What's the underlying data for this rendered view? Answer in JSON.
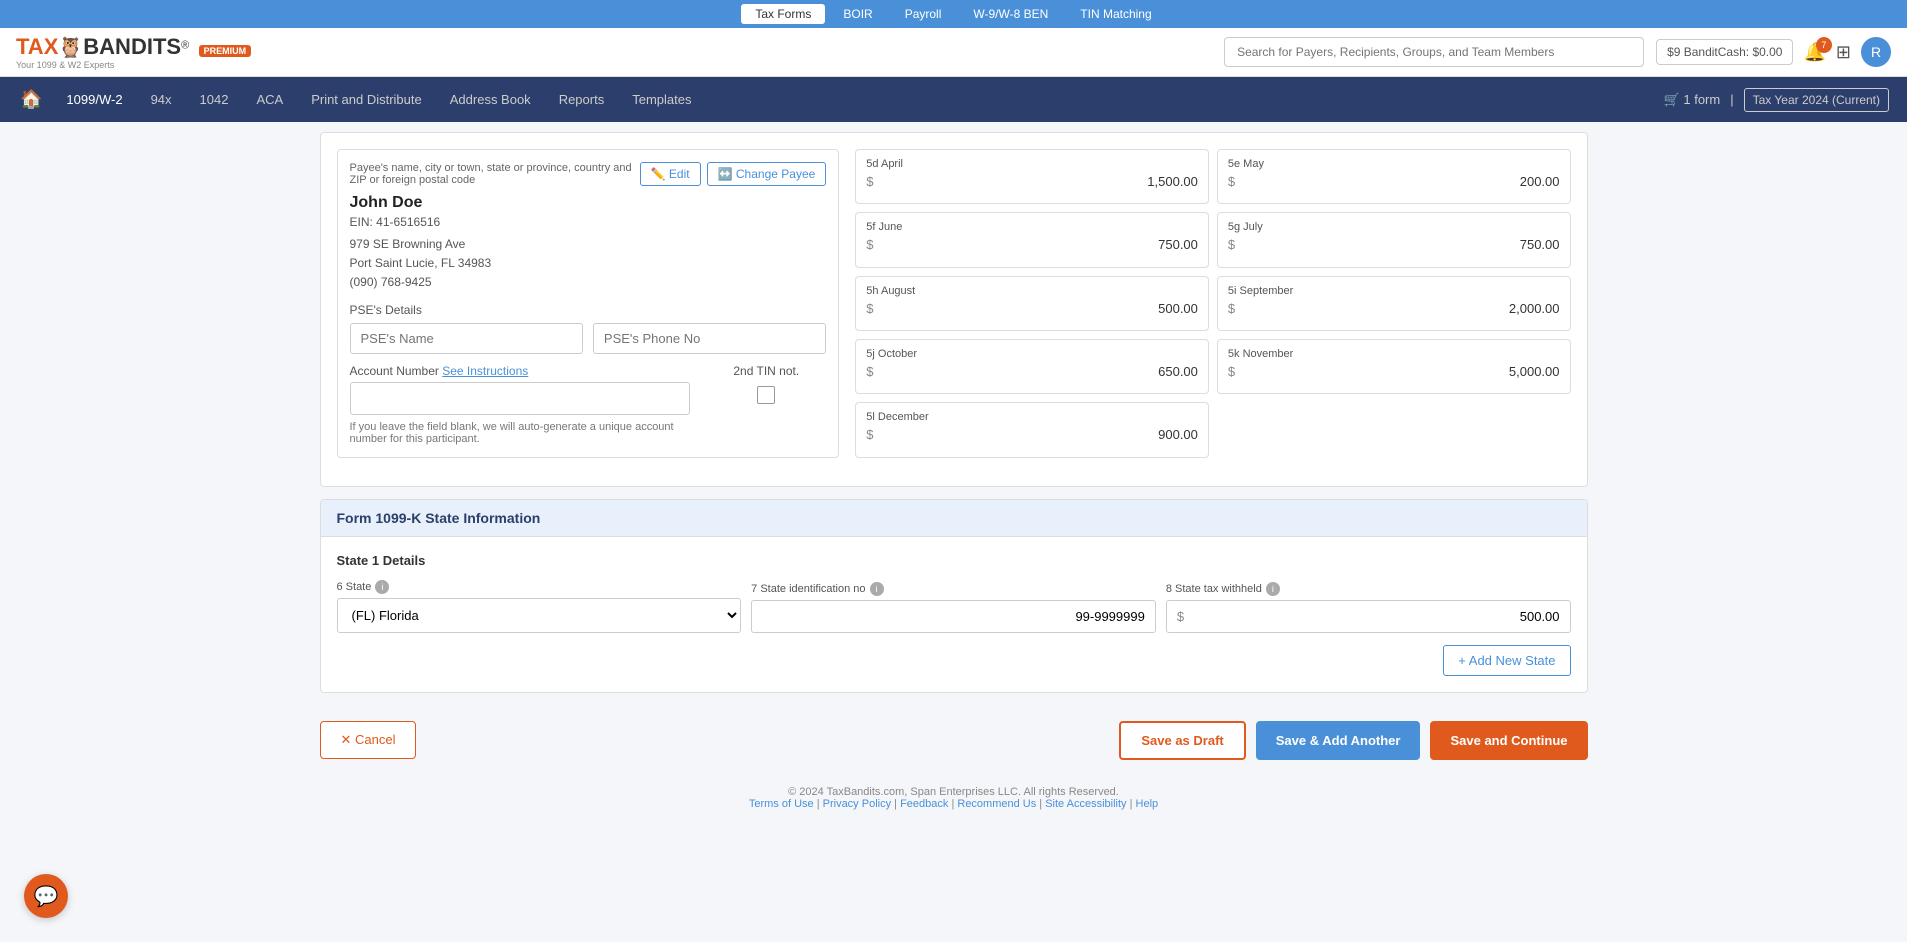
{
  "topNav": {
    "items": [
      {
        "label": "Tax Forms",
        "active": true
      },
      {
        "label": "BOIR",
        "active": false
      },
      {
        "label": "Payroll",
        "active": false
      },
      {
        "label": "W-9/W-8 BEN",
        "active": false
      },
      {
        "label": "TIN Matching",
        "active": false
      }
    ]
  },
  "header": {
    "logo": "TAXBANDITS",
    "logoSub": "Your 1099 & W2 Experts",
    "premium": "PREMIUM",
    "searchPlaceholder": "Search for Payers, Recipients, Groups, and Team Members",
    "banditCash": "$9 BanditCash: $0.00",
    "notifCount": "7",
    "avatar": "R"
  },
  "secondNav": {
    "items": [
      {
        "label": "1099/W-2",
        "hasDropdown": true,
        "active": true
      },
      {
        "label": "94x",
        "active": false
      },
      {
        "label": "1042",
        "active": false
      },
      {
        "label": "ACA",
        "active": false
      },
      {
        "label": "Print and Distribute",
        "hasDropdown": true,
        "active": false
      },
      {
        "label": "Address Book",
        "active": false
      },
      {
        "label": "Reports",
        "hasDropdown": true,
        "active": false
      },
      {
        "label": "Templates",
        "active": false
      }
    ],
    "cart": "1 form",
    "taxYear": "Tax Year 2024 (Current)"
  },
  "payee": {
    "headerLabel": "Payee's name, city or town, state or province, country and ZIP or foreign postal code",
    "editLabel": "Edit",
    "changePayeeLabel": "Change Payee",
    "name": "John Doe",
    "ein": "EIN: 41-6516516",
    "address1": "979 SE Browning Ave",
    "address2": "Port Saint Lucie, FL 34983",
    "phone": "(090) 768-9425"
  },
  "monthlyAmounts": [
    {
      "id": "5d",
      "label": "5d  April",
      "value": "1,500.00"
    },
    {
      "id": "5e",
      "label": "5e  May",
      "value": "200.00"
    },
    {
      "id": "5f",
      "label": "5f  June",
      "value": "750.00"
    },
    {
      "id": "5g",
      "label": "5g  July",
      "value": "750.00"
    },
    {
      "id": "5h",
      "label": "5h  August",
      "value": "500.00"
    },
    {
      "id": "5i",
      "label": "5i  September",
      "value": "2,000.00"
    },
    {
      "id": "5j",
      "label": "5j  October",
      "value": "650.00"
    },
    {
      "id": "5k",
      "label": "5k  November",
      "value": "5,000.00"
    },
    {
      "id": "5l",
      "label": "5l  December",
      "value": "900.00"
    }
  ],
  "pse": {
    "sectionLabel": "PSE's Details",
    "namePlaceholder": "PSE's Name",
    "phonePlaceholder": "PSE's Phone No"
  },
  "account": {
    "label": "Account Number",
    "linkLabel": "See Instructions",
    "placeholder": "",
    "note": "If you leave the field blank, we will auto-generate a unique account number for this participant.",
    "tinLabel": "2nd TIN not.",
    "tinChecked": false
  },
  "stateSection": {
    "title": "Form 1099-K  State Information",
    "stateDetailsLabel": "State 1 Details",
    "field6Label": "6  State",
    "field7Label": "7  State identification no",
    "field8Label": "8 State tax withheld",
    "stateValue": "(FL) Florida",
    "stateIdValue": "99-9999999",
    "stateTaxValue": "500.00",
    "addStateLabel": "+ Add New State"
  },
  "footer": {
    "cancelLabel": "✕ Cancel",
    "saveDraftLabel": "Save as Draft",
    "saveAddLabel": "Save & Add Another",
    "saveContinueLabel": "Save and Continue"
  },
  "pageFooter": {
    "copyright": "© 2024 TaxBandits.com, Span Enterprises LLC. All rights Reserved.",
    "links": [
      "Terms of Use",
      "Privacy Policy",
      "Feedback",
      "Recommend Us",
      "Site Accessibility",
      "Help"
    ]
  }
}
